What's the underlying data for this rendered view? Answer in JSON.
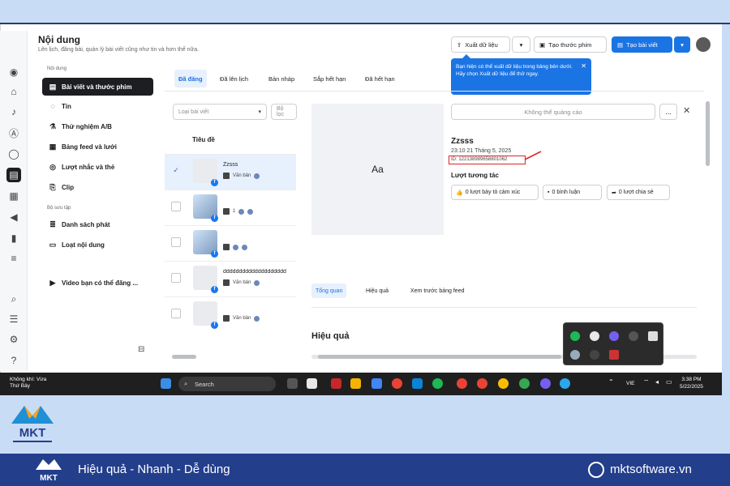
{
  "app": {
    "title": "Nội dung",
    "subtitle": "Lên lịch, đăng bài, quản lý bài viết cũng như tin và hơn thế nữa."
  },
  "toolbar": {
    "export_label": "Xuất dữ liệu",
    "create_reel_label": "Tạo thước phim",
    "create_post_label": "Tạo bài viết"
  },
  "tooltip": {
    "text": "Bạn hiện có thể xuất dữ liệu trong bảng bên dưới. Hãy chọn Xuất dữ liệu để thử ngay."
  },
  "nav": {
    "section1": "Nội dung",
    "items": [
      {
        "label": "Bài viết và thước phim"
      },
      {
        "label": "Tin"
      },
      {
        "label": "Thử nghiệm A/B"
      },
      {
        "label": "Bảng feed và lưới"
      },
      {
        "label": "Lượt nhắc và thẻ"
      },
      {
        "label": "Clip"
      }
    ],
    "section2": "Bộ sưu tập",
    "items2": [
      {
        "label": "Danh sách phát"
      },
      {
        "label": "Loạt nội dung"
      }
    ],
    "video_item": "Video bạn có thể đăng ..."
  },
  "tabs": [
    "Đã đăng",
    "Đã lên lịch",
    "Bản nháp",
    "Sắp hết hạn",
    "Đã hết hạn"
  ],
  "filters": {
    "post_type": "Loại bài viết",
    "filter": "Bộ lọc"
  },
  "table": {
    "column_title": "Tiêu đề",
    "rows": [
      {
        "title": "Zzsss",
        "type": "Văn bản"
      },
      {
        "title": "",
        "type": "1"
      },
      {
        "title": "",
        "type": ""
      },
      {
        "title": "dddddddddddddddddddd",
        "type": "Văn bản"
      },
      {
        "title": "",
        "type": "Văn bản"
      }
    ]
  },
  "detail": {
    "preview_text": "Aa",
    "boost_label": "Không thể quảng cáo",
    "more_label": "...",
    "title": "Zzsss",
    "date": "23:10 21 Tháng 5, 2025",
    "id": "ID: 122138989658801062",
    "interactions_heading": "Lượt tương tác",
    "reactions": "0 lượt bày tỏ cảm xúc",
    "comments": "0 bình luận",
    "shares": "0 lượt chia sẻ",
    "tabs": [
      "Tổng quan",
      "Hiệu quả",
      "Xem trước bảng feed"
    ],
    "perf_heading": "Hiệu quả"
  },
  "taskbar": {
    "weather_line1": "Không khí: Vừa",
    "weather_line2": "Thứ Bảy",
    "search_placeholder": "Search",
    "lang": "VIE",
    "time": "3:38 PM",
    "date": "5/22/2025"
  },
  "brand": {
    "slogan": "Hiệu quả - Nhanh - Dễ dùng",
    "website": "mktsoftware.vn",
    "logo_text": "MKT",
    "primary_color": "#233e8b",
    "accent_color": "#1b74e4"
  }
}
